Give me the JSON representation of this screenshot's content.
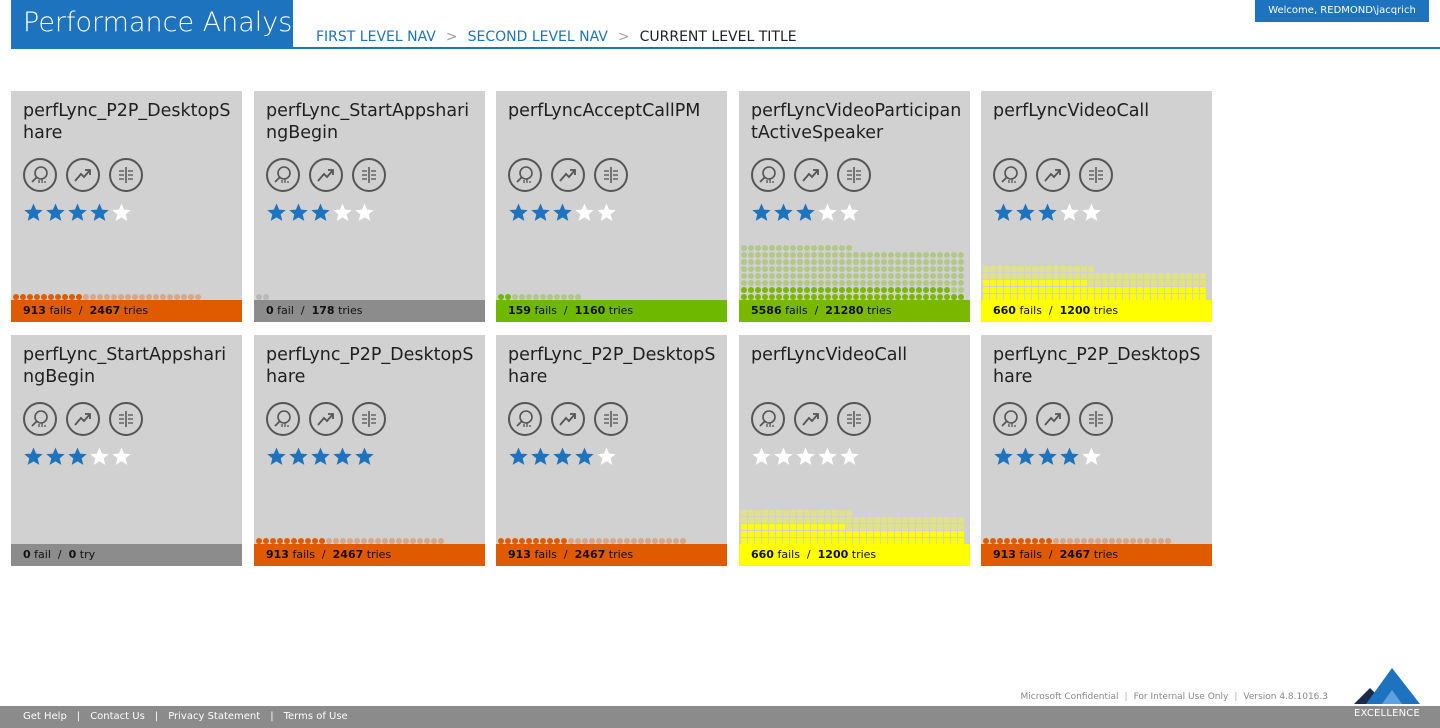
{
  "app": {
    "title": "Performance Analysis",
    "welcome": "Welcome, REDMOND\\jacqrich"
  },
  "breadcrumb": {
    "first": "FIRST LEVEL NAV",
    "second": "SECOND LEVEL NAV",
    "current": "CURRENT LEVEL TITLE",
    "separator": ">"
  },
  "colors": {
    "accent": "#1e73be",
    "tile_bg": "#d1d1d1",
    "star_on": "#1e73be",
    "star_off": "#ffffff",
    "orange": "#e05a00",
    "gray": "#8c8c8c",
    "green": "#6fb800",
    "lime": "#7ab800",
    "yellow": "#ffff00"
  },
  "icons": [
    "search-chart-icon",
    "trend-icon",
    "compare-icon"
  ],
  "tiles": [
    {
      "title": "perfLync_P2P_DesktopShare",
      "stars": 4,
      "fails": "913",
      "fails_label": "fails",
      "tries": "2467",
      "tries_label": "tries",
      "status": "orange",
      "fail_ratio": 0.37
    },
    {
      "title": "perfLync_StartAppsharingBegin",
      "stars": 3,
      "fails": "0",
      "fails_label": "fail",
      "tries": "178",
      "tries_label": "tries",
      "status": "gray",
      "fail_ratio": 0.0
    },
    {
      "title": "perfLyncAcceptCallPM",
      "stars": 3,
      "fails": "159",
      "fails_label": "fails",
      "tries": "1160",
      "tries_label": "tries",
      "status": "green",
      "fail_ratio": 0.14
    },
    {
      "title": "perfLyncVideoParticipantActiveSpeaker",
      "stars": 3,
      "fails": "5586",
      "fails_label": "fails",
      "tries": "21280",
      "tries_label": "tries",
      "status": "lime",
      "fail_ratio": 0.26
    },
    {
      "title": "perfLyncVideoCall",
      "stars": 3,
      "fails": "660",
      "fails_label": "fails",
      "tries": "1200",
      "tries_label": "tries",
      "status": "yellow",
      "fail_ratio": 0.55
    },
    {
      "title": "perfLync_StartAppsharingBegin",
      "stars": 3,
      "fails": "0",
      "fails_label": "fail",
      "tries": "0",
      "tries_label": "try",
      "status": "gray",
      "fail_ratio": 0.0
    },
    {
      "title": "perfLync_P2P_DesktopShare",
      "stars": 5,
      "fails": "913",
      "fails_label": "fails",
      "tries": "2467",
      "tries_label": "tries",
      "status": "orange",
      "fail_ratio": 0.37
    },
    {
      "title": "perfLync_P2P_DesktopShare",
      "stars": 4,
      "fails": "913",
      "fails_label": "fails",
      "tries": "2467",
      "tries_label": "tries",
      "status": "orange",
      "fail_ratio": 0.37
    },
    {
      "title": "perfLyncVideoCall",
      "stars": 0,
      "fails": "660",
      "fails_label": "fails",
      "tries": "1200",
      "tries_label": "tries",
      "status": "yellow",
      "fail_ratio": 0.55
    },
    {
      "title": "perfLync_P2P_DesktopShare",
      "stars": 4,
      "fails": "913",
      "fails_label": "fails",
      "tries": "2467",
      "tries_label": "tries",
      "status": "orange",
      "fail_ratio": 0.37
    }
  ],
  "footer": {
    "confidential": "Microsoft Confidential",
    "internal": "For Internal Use Only",
    "version": "Version 4.8.1016.3",
    "links": [
      "Get Help",
      "Contact Us",
      "Privacy Statement",
      "Terms of Use"
    ],
    "logo_text": "EXCELLENCE"
  }
}
